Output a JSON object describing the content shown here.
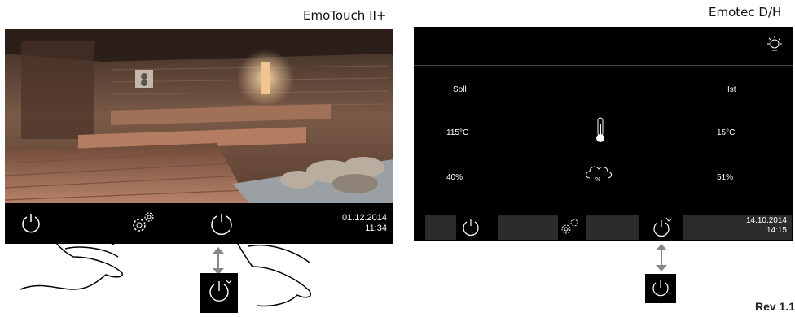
{
  "left": {
    "caption": "EmoTouch II+",
    "date": "01.12.2014",
    "time": "11:34"
  },
  "right": {
    "caption": "Emotec D/H",
    "soll_label": "Soll",
    "ist_label": "Ist",
    "soll_temp": "115°C",
    "ist_temp": "15°C",
    "soll_humidity": "40%",
    "ist_humidity": "51%",
    "date": "14.10.2014",
    "time": "14:15"
  },
  "page_hint": "Rev 1.1"
}
